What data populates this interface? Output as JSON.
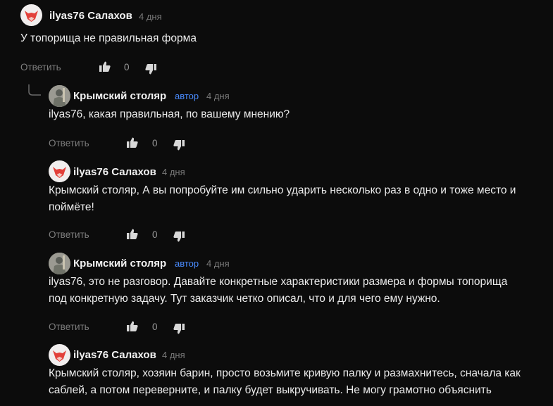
{
  "comments": [
    {
      "author": "ilyas76 Салахов",
      "avatar": "fox-avatar",
      "badge": "",
      "time": "4 дня",
      "lines": [
        "У топорища не правильная форма"
      ],
      "reply_label": "Ответить",
      "likes": "0"
    },
    {
      "author": "Крымский столяр",
      "avatar": "carpenter-avatar",
      "badge": "автор",
      "time": "4 дня",
      "lines": [
        "ilyas76, какая правильная, по вашему мнению?"
      ],
      "reply_label": "Ответить",
      "likes": "0"
    },
    {
      "author": "ilyas76 Салахов",
      "avatar": "fox-avatar",
      "badge": "",
      "time": "4 дня",
      "lines": [
        "Крымский столяр, А вы попробуйте им сильно ударить несколько раз в одно и тоже место и",
        "поймёте!"
      ],
      "reply_label": "Ответить",
      "likes": "0"
    },
    {
      "author": "Крымский столяр",
      "avatar": "carpenter-avatar",
      "badge": "автор",
      "time": "4 дня",
      "lines": [
        "ilyas76, это не разговор. Давайте конкретные характеристики размера и формы топорища",
        "под конкретную задачу. Тут заказчик четко описал, что и для чего ему нужно."
      ],
      "reply_label": "Ответить",
      "likes": "0"
    },
    {
      "author": "ilyas76 Салахов",
      "avatar": "fox-avatar",
      "badge": "",
      "time": "4 дня",
      "lines": [
        "Крымский столяр, хозяин барин, просто возьмите кривую палку и размахнитесь, сначала как",
        "саблей, а потом переверните, и палку будет выкручивать. Не могу грамотно объяснить"
      ],
      "reply_label": "",
      "likes": ""
    }
  ],
  "colors": {
    "background": "#0c0c0c",
    "author_badge": "#4a8cff",
    "meta": "#7a7a7a"
  }
}
